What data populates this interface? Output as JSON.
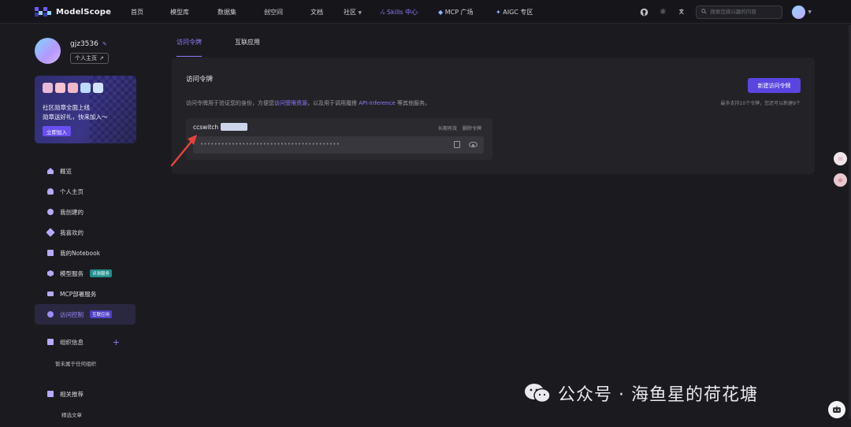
{
  "topbar": {
    "logo_text": "ModelScope",
    "nav": [
      "首页",
      "模型库",
      "数据集",
      "创空间",
      "文档",
      "社区",
      "Skills 中心",
      "MCP 广场",
      "AIGC 专区"
    ],
    "search_placeholder": "搜索您感兴趣的内容"
  },
  "profile": {
    "username": "gjz3536",
    "homepage_label": "个人主页"
  },
  "banner": {
    "line1": "社区勋章全面上线",
    "line2": "勋章送好礼，快来加入～",
    "button": "立即加入"
  },
  "menu": [
    {
      "label": "概览"
    },
    {
      "label": "个人主页"
    },
    {
      "label": "我创建的"
    },
    {
      "label": "我喜欢的"
    },
    {
      "label": "我的Notebook"
    },
    {
      "label": "模型服务",
      "tag": "评测服务"
    },
    {
      "label": "MCP部署服务"
    },
    {
      "label": "访问控制",
      "tag": "互联应用"
    }
  ],
  "org": {
    "title": "组织信息",
    "empty": "暂未属于任何组织"
  },
  "recommend": {
    "title": "相关推荐",
    "item": "精选文章"
  },
  "tabs": [
    "访问令牌",
    "互联应用"
  ],
  "card": {
    "title": "访问令牌",
    "desc_pre": "访问令牌用于验证您的身份，方便您",
    "desc_link1": "访问受限资源",
    "desc_mid": "，以及用于调用魔搭 ",
    "desc_link2": "API-Inference",
    "desc_post": " 等其他服务。",
    "new_button": "新建访问令牌",
    "limit_note": "最多支持10个令牌，您还可以新建9个"
  },
  "token": {
    "name": "ccswitch",
    "validity": "长期有效",
    "delete": "删除令牌",
    "masked": "••••••••••••••••••••••••••••••••••••••••"
  },
  "watermark": "公众号 · 海鱼星的荷花塘"
}
